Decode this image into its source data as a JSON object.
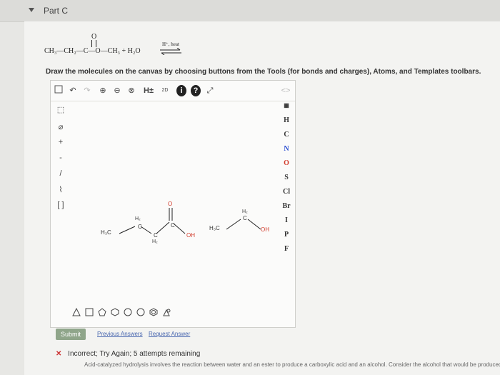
{
  "part": {
    "title": "Part C"
  },
  "equation": {
    "lhs": "CH₃—CH₂—C—O—CH₃ + H₂O",
    "carbonyl_o": "O",
    "cond": "H⁺, heat"
  },
  "instructions": "Draw the molecules on the canvas by choosing buttons from the Tools (for bonds and charges), Atoms, and Templates toolbars.",
  "toolbar": {
    "hplus": "H±",
    "twoD": "2D",
    "info": "i",
    "help": "?"
  },
  "atoms": [
    "H",
    "C",
    "N",
    "O",
    "S",
    "Cl",
    "Br",
    "I",
    "P",
    "F"
  ],
  "canvas": {
    "mol1": {
      "h3c": "H₃C",
      "ch2": "H₂",
      "c": "C",
      "o": "O",
      "oh": "OH",
      "h2b": "H₂"
    },
    "mol2": {
      "h3c": "H₃C",
      "h2": "H₂",
      "c": "C",
      "oh": "OH"
    }
  },
  "buttons": {
    "submit": "Submit",
    "previous": "Previous Answers",
    "request": "Request Answer"
  },
  "feedback": {
    "status": "Incorrect; Try Again; 5 attempts remaining",
    "hint": "Acid-catalyzed hydrolysis involves the reaction between water and an ester to produce a carboxylic acid and an alcohol. Consider the alcohol that would be produced."
  },
  "colors": {
    "oxygen": "#d23a2a",
    "nitrogen": "#2a4ed2",
    "accent": "#8fa58a"
  }
}
